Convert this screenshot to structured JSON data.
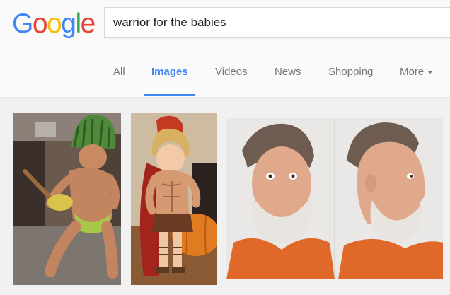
{
  "logo": {
    "letters": [
      {
        "char": "G",
        "color": "#4285f4"
      },
      {
        "char": "o",
        "color": "#ea4335"
      },
      {
        "char": "o",
        "color": "#fbbc05"
      },
      {
        "char": "g",
        "color": "#4285f4"
      },
      {
        "char": "l",
        "color": "#34a853"
      },
      {
        "char": "e",
        "color": "#ea4335"
      }
    ]
  },
  "search": {
    "value": "warrior for the babies"
  },
  "tabs": {
    "all": "All",
    "images": "Images",
    "videos": "Videos",
    "news": "News",
    "shopping": "Shopping",
    "more": "More"
  },
  "colors": {
    "accent": "#4285f4",
    "tab_text": "#777777",
    "background": "#f1f1f1"
  },
  "results": [
    {
      "icon": "child-warrior-watermelon-photo"
    },
    {
      "icon": "baby-spartan-costume-photo"
    },
    {
      "icon": "mugshot-front-and-profile-photo"
    }
  ]
}
